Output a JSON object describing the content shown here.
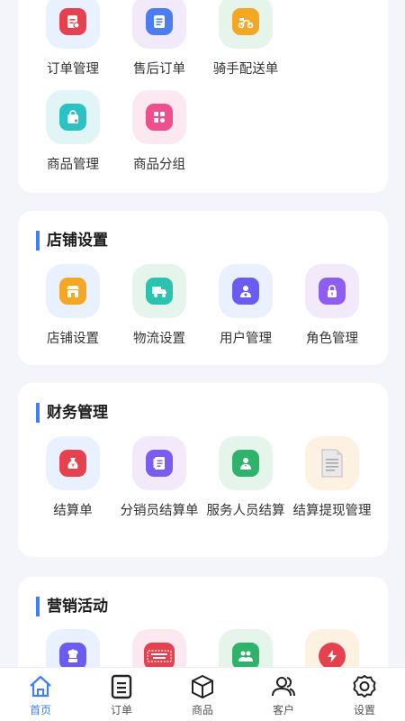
{
  "sections": {
    "orders": {
      "items": [
        {
          "label": "订单管理",
          "icon": "order-icon",
          "color": "#e6414e"
        },
        {
          "label": "售后订单",
          "icon": "after-sales-icon",
          "color": "#4b7cf0"
        },
        {
          "label": "骑手配送单",
          "icon": "scooter-icon",
          "color": "#f5a623"
        },
        {
          "label": "商品管理",
          "icon": "shopping-bag-icon",
          "color": "#2bc2c4"
        },
        {
          "label": "商品分组",
          "icon": "grid-icon",
          "color": "#ef4f8c"
        }
      ]
    },
    "store": {
      "title": "店铺设置",
      "items": [
        {
          "label": "店铺设置",
          "icon": "store-icon",
          "color": "#f5a623"
        },
        {
          "label": "物流设置",
          "icon": "truck-icon",
          "color": "#2bc2b0"
        },
        {
          "label": "用户管理",
          "icon": "user-icon",
          "color": "#6a5cf0"
        },
        {
          "label": "角色管理",
          "icon": "lock-icon",
          "color": "#8e5ef0"
        }
      ]
    },
    "finance": {
      "title": "财务管理",
      "items": [
        {
          "label": "结算单",
          "icon": "money-bag-icon",
          "color": "#e6414e"
        },
        {
          "label": "分销员结算单",
          "icon": "document-icon",
          "color": "#7a5cf0"
        },
        {
          "label": "服务人员结算",
          "icon": "staff-icon",
          "color": "#2fb36b"
        },
        {
          "label": "结算提现管理",
          "icon": "paper-icon",
          "color": "#bdbdbd"
        }
      ]
    },
    "marketing": {
      "title": "营销活动",
      "items": [
        {
          "label": "",
          "icon": "chef-icon",
          "color": "#6a5cf0"
        },
        {
          "label": "",
          "icon": "ticket-icon",
          "color": "#e6414e"
        },
        {
          "label": "",
          "icon": "group-icon",
          "color": "#2fb36b"
        },
        {
          "label": "",
          "icon": "flash-icon",
          "color": "#e6414e"
        }
      ]
    }
  },
  "tabbar": {
    "active_color": "#3f7ef7",
    "items": [
      {
        "label": "首页",
        "icon": "home-icon"
      },
      {
        "label": "订单",
        "icon": "list-icon"
      },
      {
        "label": "商品",
        "icon": "box-icon"
      },
      {
        "label": "客户",
        "icon": "customers-icon"
      },
      {
        "label": "设置",
        "icon": "settings-icon"
      }
    ]
  }
}
